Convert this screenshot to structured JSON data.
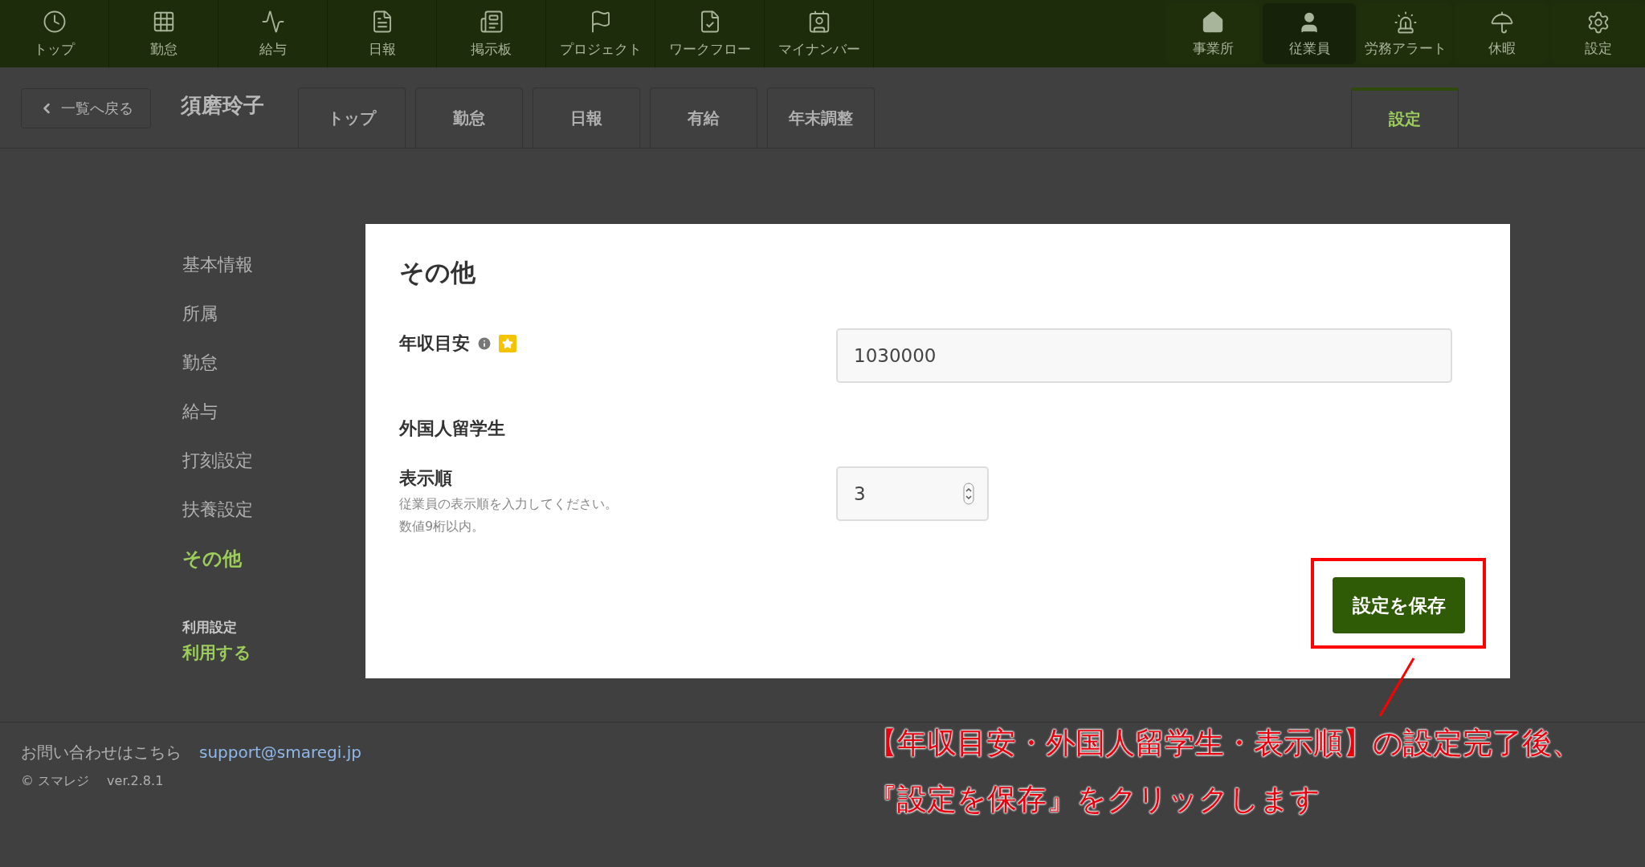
{
  "top_nav": {
    "left_items": [
      {
        "label": "トップ"
      },
      {
        "label": "勤怠"
      },
      {
        "label": "給与"
      },
      {
        "label": "日報"
      },
      {
        "label": "掲示板"
      },
      {
        "label": "プロジェクト"
      },
      {
        "label": "ワークフロー"
      },
      {
        "label": "マイナンバー"
      }
    ],
    "right_items": [
      {
        "label": "事業所",
        "selected": false
      },
      {
        "label": "従業員",
        "selected": true
      },
      {
        "label": "労務アラート",
        "selected": false
      },
      {
        "label": "休暇",
        "selected": false
      },
      {
        "label": "設定",
        "selected": false
      }
    ]
  },
  "header": {
    "back_button": "一覧へ戻る",
    "employee_name": "須磨玲子",
    "tabs": [
      {
        "label": "トップ",
        "selected": false
      },
      {
        "label": "勤怠",
        "selected": false
      },
      {
        "label": "日報",
        "selected": false
      },
      {
        "label": "有給",
        "selected": false
      },
      {
        "label": "年末調整",
        "selected": false
      },
      {
        "label": "設定",
        "selected": true
      }
    ]
  },
  "sidebar": {
    "items": [
      {
        "label": "基本情報",
        "selected": false
      },
      {
        "label": "所属",
        "selected": false
      },
      {
        "label": "勤怠",
        "selected": false
      },
      {
        "label": "給与",
        "selected": false
      },
      {
        "label": "打刻設定",
        "selected": false
      },
      {
        "label": "扶養設定",
        "selected": false
      },
      {
        "label": "その他",
        "selected": true
      }
    ],
    "usage": {
      "label": "利用設定",
      "value": "利用する"
    }
  },
  "modal": {
    "title": "その他",
    "fields": [
      {
        "kind": "text",
        "label": "年収目安",
        "value": "1030000"
      },
      {
        "kind": "section",
        "label": "外国人留学生"
      },
      {
        "kind": "number",
        "label": "表示順",
        "value": "3",
        "help": [
          "従業員の表示順を入力してください。",
          "数値9桁以内。"
        ]
      }
    ],
    "save_button": "設定を保存"
  },
  "footer": {
    "contact_text": "お問い合わせはこちら",
    "email": "support@smaregi.jp",
    "copyright": "© スマレジ",
    "version": "ver.2.8.1"
  },
  "annotation": {
    "lines": [
      "【年収目安・外国人留学生・表示順】の設定完了後、",
      "『設定を保存』をクリックします"
    ]
  }
}
